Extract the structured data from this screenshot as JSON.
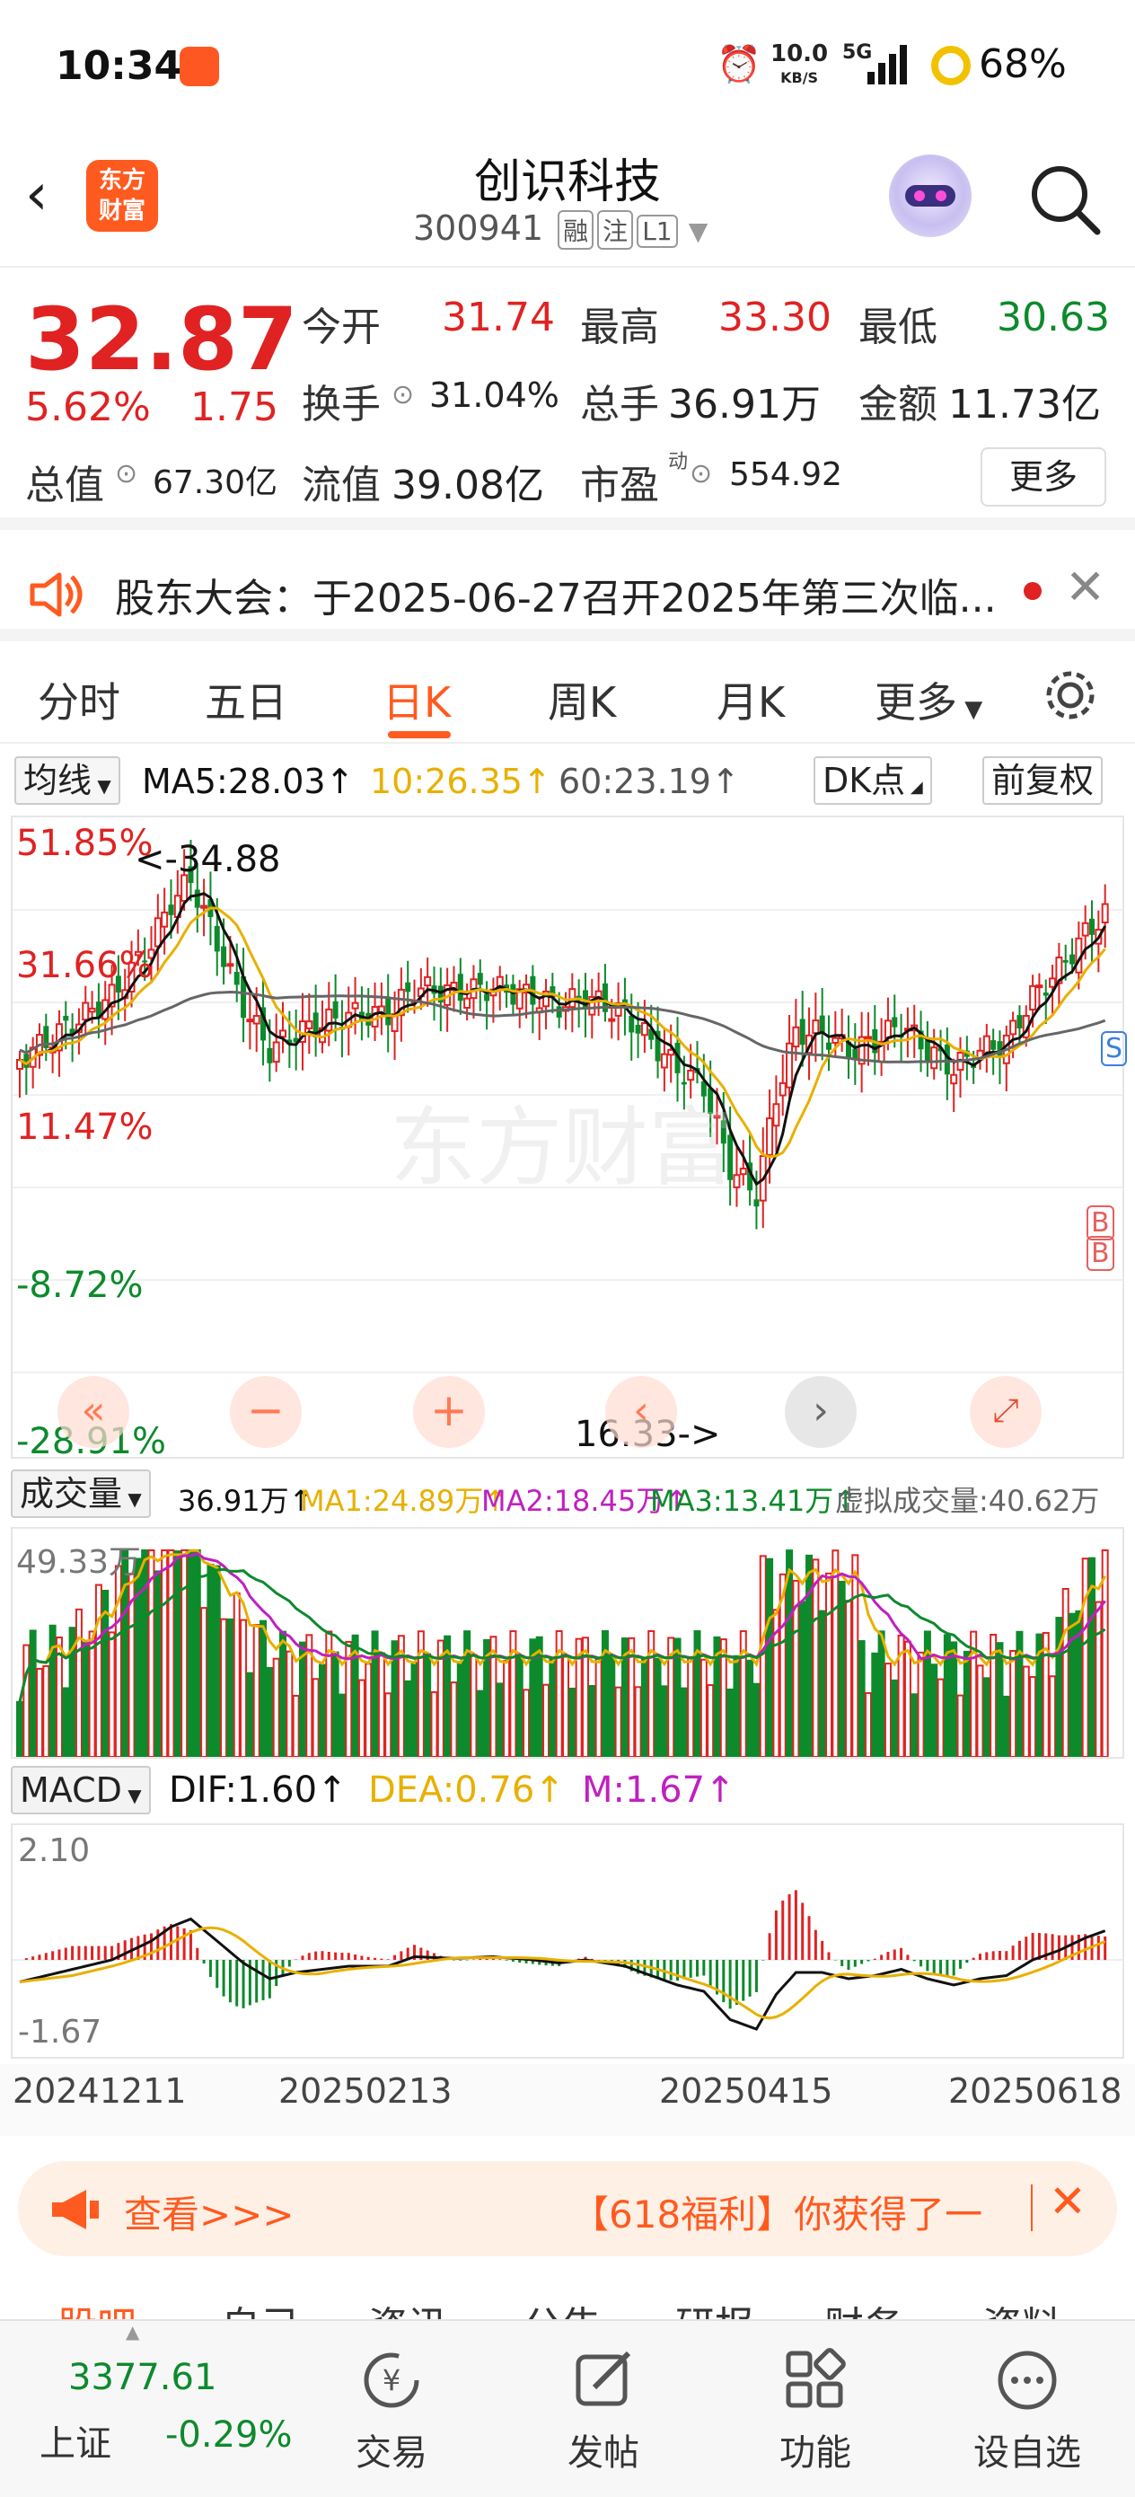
{
  "status": {
    "time": "10:34",
    "speed_top": "10.0",
    "speed_unit": "KB/S",
    "network": "5G",
    "battery": "68%"
  },
  "header": {
    "logo_line1": "东方",
    "logo_line2": "财富",
    "title": "创识科技",
    "code": "300941",
    "tags": [
      "融",
      "注",
      "L1"
    ]
  },
  "quote": {
    "price": "32.87",
    "pct": "5.62%",
    "change": "1.75",
    "open_label": "今开",
    "open": "31.74",
    "high_label": "最高",
    "high": "33.30",
    "low_label": "最低",
    "low": "30.63",
    "turnover_label": "换手",
    "turnover": "31.04%",
    "vol_label": "总手",
    "vol": "36.91万",
    "amount_label": "金额",
    "amount": "11.73亿",
    "cap_label": "总值",
    "cap": "67.30亿",
    "float_label": "流值",
    "float": "39.08亿",
    "pe_label": "市盈",
    "pe_sup": "动",
    "pe": "554.92",
    "more": "更多"
  },
  "notice": {
    "text": "股东大会：于2025-06-27召开2025年第三次临..."
  },
  "tabs": [
    "分时",
    "五日",
    "日K",
    "周K",
    "月K",
    "更多"
  ],
  "ma": {
    "selector": "均线",
    "ma5": "MA5:28.03",
    "ma10": "10:26.35",
    "ma60": "60:23.19",
    "dk": "DK点",
    "fq": "前复权"
  },
  "kchart": {
    "y_labels": [
      "51.85%",
      "31.66%",
      "11.47%",
      "-8.72%",
      "-28.91%"
    ],
    "high_mark": "<-34.88",
    "low_mark": "16.33->",
    "watermark": "东方财富",
    "markers": [
      "S",
      "B",
      "B"
    ]
  },
  "vol": {
    "selector": "成交量",
    "cur": "36.91万",
    "ma1": "MA1:24.89万",
    "ma2": "MA2:18.45万",
    "ma3": "MA3:13.41万",
    "virtual": "虚拟成交量:40.62万",
    "max": "49.33万"
  },
  "macd": {
    "selector": "MACD",
    "dif": "DIF:1.60",
    "dea": "DEA:0.76",
    "m": "M:1.67",
    "top": "2.10",
    "bottom": "-1.67"
  },
  "dates": [
    "20241211",
    "20250213",
    "20250415",
    "20250618"
  ],
  "ad": {
    "view": "查看>>>",
    "text": "【618福利】你获得了一"
  },
  "nav": {
    "index_value": "3377.61",
    "index_name": "上证",
    "index_pct": "-0.29%",
    "items": [
      "交易",
      "发帖",
      "功能",
      "设自选"
    ],
    "peek": [
      "股吧",
      "自己",
      "资讯",
      "公告",
      "研报",
      "财务",
      "资料"
    ]
  },
  "colors": {
    "up": "#e02222",
    "down": "#0d8a2c",
    "accent": "#ff5a1f"
  }
}
